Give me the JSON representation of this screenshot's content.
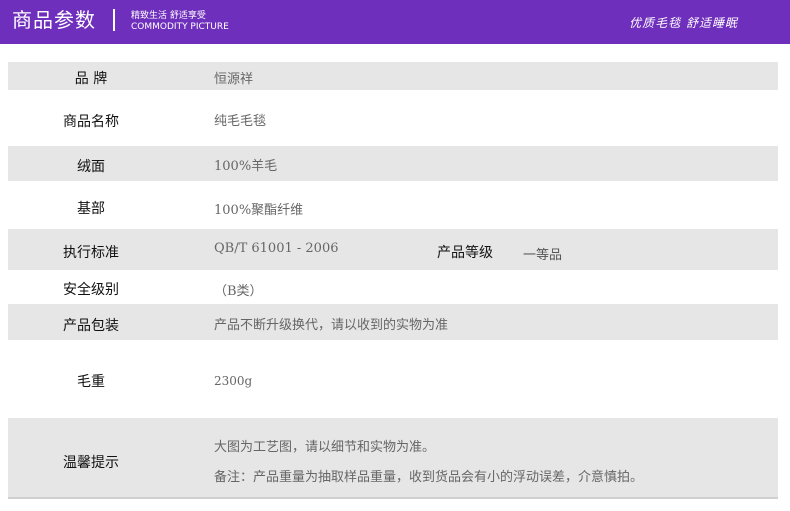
{
  "banner": {
    "title": "商品参数",
    "sub_line1": "精致生活  舒适享受",
    "sub_line2": "COMMODITY PICTURE",
    "right_text": "优质毛毯  舒适睡眠"
  },
  "params": [
    {
      "label": "品 牌",
      "value": "恒源祥"
    },
    {
      "label": "商品名称",
      "value": "纯毛毛毯"
    },
    {
      "label": "绒面",
      "value": "100%羊毛"
    },
    {
      "label": "基部",
      "value": "100%聚酯纤维"
    },
    {
      "label": "执行标准",
      "value": "QB/T  61001 - 2006",
      "label2": "产品等级",
      "value2": "一等品"
    },
    {
      "label": "安全级别",
      "value": "（B类）"
    },
    {
      "label": "产品包装",
      "value": "产品不断升级换代，请以收到的实物为准"
    },
    {
      "label": "毛重",
      "value": "2300g"
    },
    {
      "label": "温馨提示",
      "value": "大图为工艺图，请以细节和实物为准。",
      "value_line2": "备注：产品重量为抽取样品重量，收到货品会有小的浮动误差，介意慎拍。"
    }
  ]
}
